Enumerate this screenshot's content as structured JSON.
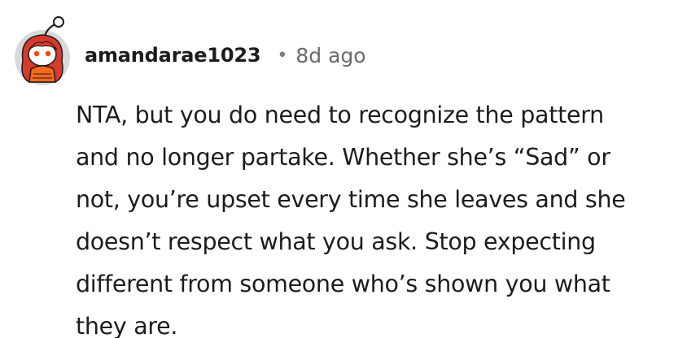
{
  "comment": {
    "author": "amandarae1023",
    "separator": "•",
    "age": "8d ago",
    "avatar_icon": "reddit-snoo-avatar-icon",
    "colors": {
      "avatar_bg": "#d7dadc",
      "avatar_hair": "#d93a2b",
      "username": "#1c1c1c",
      "meta": "#6a6a6a",
      "text": "#1c1c1c"
    },
    "text_lines": [
      "NTA, but you do need to recognize the pattern",
      "and no longer partake. Whether she’s “Sad” or",
      "not, you’re upset every time she leaves and she",
      "doesn’t respect what you ask. Stop expecting",
      "different from someone who’s shown you what",
      "they are."
    ]
  }
}
